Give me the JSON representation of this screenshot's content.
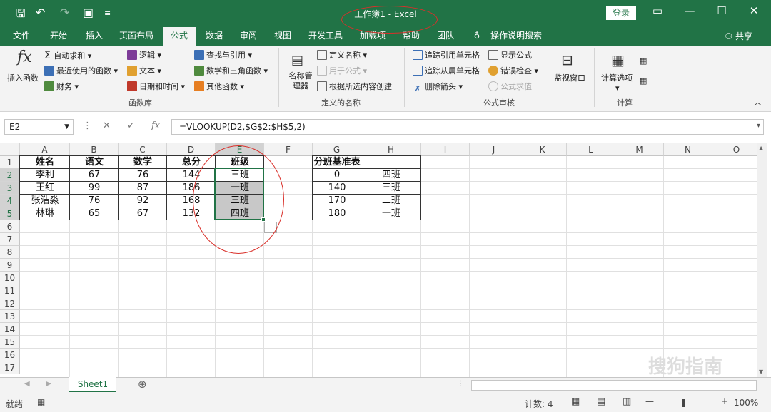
{
  "window": {
    "title": "工作簿1 - Excel",
    "login": "登录"
  },
  "tabs": [
    "文件",
    "开始",
    "插入",
    "页面布局",
    "公式",
    "数据",
    "审阅",
    "视图",
    "开发工具",
    "加载项",
    "帮助",
    "团队",
    "操作说明搜索"
  ],
  "share": "共享",
  "ribbon": {
    "insert_function": "插入函数",
    "autosum": "自动求和",
    "recent": "最近使用的函数",
    "finance": "财务",
    "logic": "逻辑",
    "text": "文本",
    "datetime": "日期和时间",
    "lookup": "查找与引用",
    "math": "数学和三角函数",
    "other": "其他函数",
    "group_functions": "函数库",
    "name_manager": "名称管理器",
    "define_name": "定义名称",
    "use_in_formula": "用于公式",
    "create_from_sel": "根据所选内容创建",
    "group_names": "定义的名称",
    "trace_prec": "追踪引用单元格",
    "trace_dep": "追踪从属单元格",
    "remove_arrows": "删除箭头",
    "show_formulas": "显示公式",
    "error_check": "错误检查",
    "eval_formula": "公式求值",
    "watch_window": "监视窗口",
    "group_audit": "公式审核",
    "calc_options": "计算选项",
    "group_calc": "计算"
  },
  "formula_bar": {
    "name_box": "E2",
    "formula": "=VLOOKUP(D2,$G$2:$H$5,2)",
    "fx": "fx"
  },
  "columns": [
    "A",
    "B",
    "C",
    "D",
    "E",
    "F",
    "G",
    "H",
    "I",
    "J",
    "K",
    "L",
    "M",
    "N",
    "O"
  ],
  "rows": [
    "1",
    "2",
    "3",
    "4",
    "5",
    "6",
    "7",
    "8",
    "9",
    "10",
    "11",
    "12",
    "13",
    "14",
    "15",
    "16",
    "17"
  ],
  "table1": {
    "headers": [
      "姓名",
      "语文",
      "数学",
      "总分",
      "班级"
    ],
    "rows": [
      [
        "李利",
        "67",
        "76",
        "144",
        "三班"
      ],
      [
        "王红",
        "99",
        "87",
        "186",
        "一班"
      ],
      [
        "张浩淼",
        "76",
        "92",
        "168",
        "三班"
      ],
      [
        "林琳",
        "65",
        "67",
        "132",
        "四班"
      ]
    ]
  },
  "table2": {
    "header": "分班基准表",
    "rows": [
      [
        "0",
        "四班"
      ],
      [
        "140",
        "三班"
      ],
      [
        "170",
        "二班"
      ],
      [
        "180",
        "一班"
      ]
    ]
  },
  "sheet_tab": "Sheet1",
  "status": {
    "ready": "就绪",
    "count": "计数: 4",
    "zoom": "100%"
  },
  "watermark": "搜狗指南",
  "colors": {
    "excel_green": "#217346",
    "annotation_red": "#d9302a"
  }
}
